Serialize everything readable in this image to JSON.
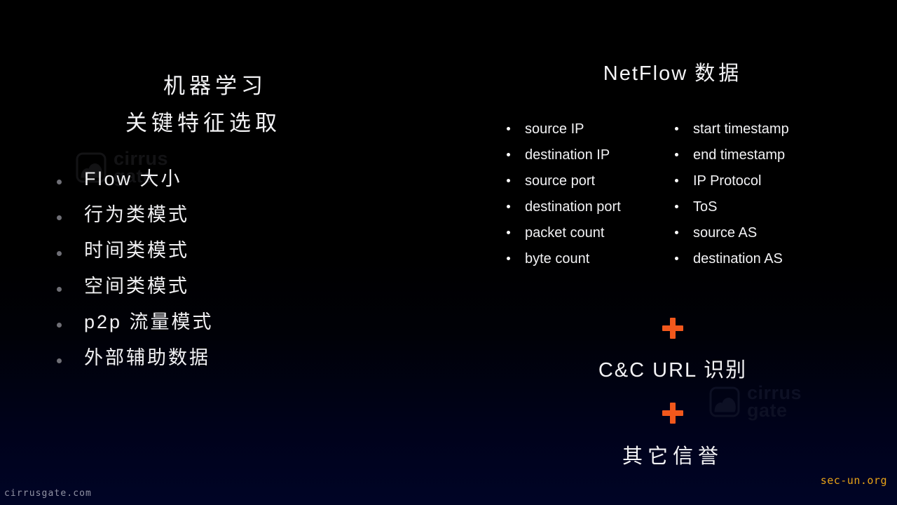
{
  "slide": {
    "background_top_color": "#000000",
    "background_bottom_color": "#000426",
    "accent_color": "#f2581c"
  },
  "left_panel": {
    "title_line1": "机器学习",
    "title_line2": "关键特征选取",
    "features": [
      "Flow 大小",
      "行为类模式",
      "时间类模式",
      "空间类模式",
      "p2p 流量模式",
      "外部辅助数据"
    ]
  },
  "right_panel": {
    "title_latin": "NetFlow ",
    "title_cjk": "数据",
    "netflow_fields_column1": [
      "source IP",
      "destination IP",
      "source port",
      "destination port",
      "packet count",
      "byte count"
    ],
    "netflow_fields_column2": [
      "start timestamp",
      "end timestamp",
      "IP Protocol",
      "ToS",
      "source AS",
      "destination AS"
    ],
    "combine_operator": "+",
    "stage_two": "C&C URL 识别",
    "stage_three": "其它信誉"
  },
  "watermark": {
    "line1": "cirrus",
    "line2": "gate",
    "icon": "cloud-square-icon"
  },
  "footer": {
    "site": "cirrusgate.com",
    "attribution": "sec-un.org"
  }
}
